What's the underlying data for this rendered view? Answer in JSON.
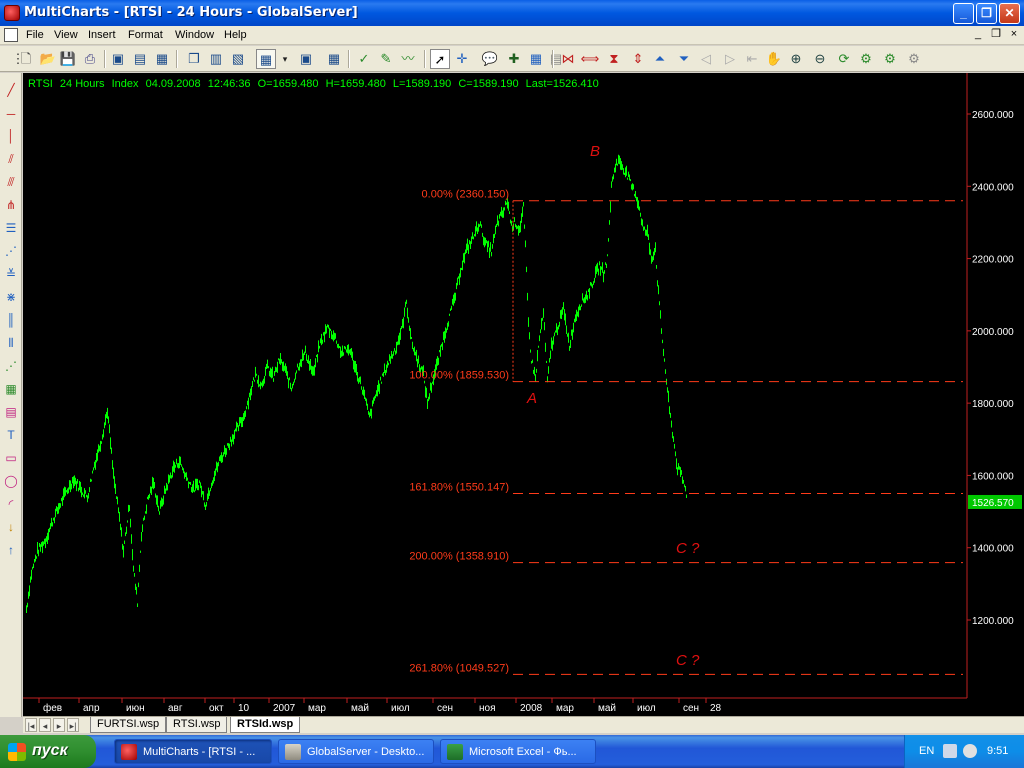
{
  "window": {
    "title": "MultiCharts - [RTSI - 24 Hours - GlobalServer]",
    "min": "_",
    "max": "❐",
    "close": "✕"
  },
  "menu": {
    "items": [
      "File",
      "View",
      "Insert",
      "Format",
      "Window",
      "Help"
    ],
    "mdi_min": "_",
    "mdi_restore": "❐",
    "mdi_close": "×"
  },
  "chart": {
    "header": {
      "symbol": "RTSI",
      "resolution": "24 Hours",
      "category": "Index",
      "date": "04.09.2008",
      "time": "12:46:36",
      "o": "O=1659.480",
      "h": "H=1659.480",
      "l": "L=1589.190",
      "c": "C=1589.190",
      "last": "Last=1526.410"
    },
    "price_axis": [
      "2600.000",
      "2400.000",
      "2200.000",
      "2000.000",
      "1800.000",
      "1600.000",
      "1400.000",
      "1200.000"
    ],
    "last_price_label": "1526.570",
    "time_axis": [
      "фев",
      "апр",
      "июн",
      "авг",
      "окт",
      "10",
      "2007",
      "мар",
      "май",
      "июл",
      "сен",
      "ноя",
      "2008",
      "мар",
      "май",
      "июл",
      "сен",
      "28"
    ],
    "fib_levels": [
      {
        "label": "0.00% (2360.150)",
        "price": 2360.15
      },
      {
        "label": "100.00% (1859.530)",
        "price": 1859.53
      },
      {
        "label": "161.80% (1550.147)",
        "price": 1550.147
      },
      {
        "label": "200.00% (1358.910)",
        "price": 1358.91
      },
      {
        "label": "261.80% (1049.527)",
        "price": 1049.527
      }
    ],
    "wave_labels": {
      "a": "A",
      "b": "B",
      "c1": "C ?",
      "c2": "C ?"
    },
    "colors": {
      "price": "#00ff00",
      "fib": "#ff3b1a",
      "wave_label": "#e01010",
      "grid_text": "#ffffff",
      "header": "#00ff00"
    }
  },
  "workspaces": {
    "tabs": [
      "FURTSI.wsp",
      "RTSI.wsp",
      "RTSId.wsp"
    ],
    "active": "RTSId.wsp"
  },
  "taskbar": {
    "start": "пуск",
    "tasks": [
      "MultiCharts - [RTSI - ...",
      "GlobalServer - Deskto...",
      "Microsoft Excel - Фь..."
    ],
    "lang": "EN",
    "clock": "9:51"
  }
}
